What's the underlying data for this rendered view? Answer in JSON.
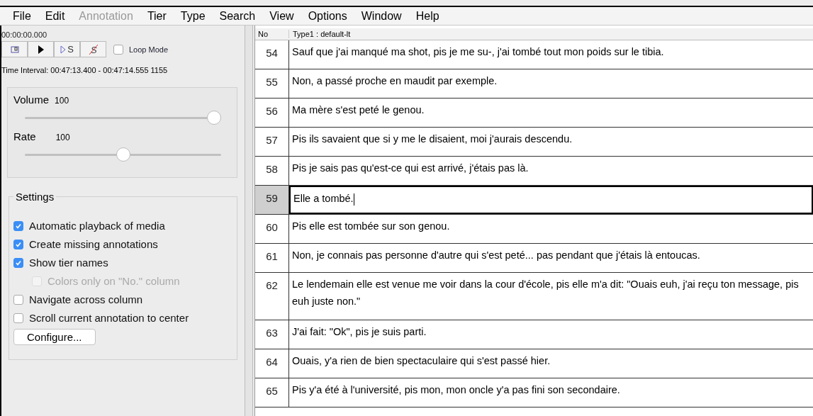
{
  "menu": [
    {
      "label": "File",
      "disabled": false
    },
    {
      "label": "Edit",
      "disabled": false
    },
    {
      "label": "Annotation",
      "disabled": true
    },
    {
      "label": "Tier",
      "disabled": false
    },
    {
      "label": "Type",
      "disabled": false
    },
    {
      "label": "Search",
      "disabled": false
    },
    {
      "label": "View",
      "disabled": false
    },
    {
      "label": "Options",
      "disabled": false
    },
    {
      "label": "Window",
      "disabled": false
    },
    {
      "label": "Help",
      "disabled": false
    }
  ],
  "player": {
    "time": "00:00:00.000",
    "buttons": [
      {
        "kind": "selection"
      },
      {
        "kind": "play"
      },
      {
        "kind": "play-s",
        "label": "S"
      },
      {
        "kind": "clear-s",
        "label": "S"
      }
    ],
    "loop_mode": {
      "label": "Loop Mode",
      "checked": false
    },
    "interval": "Time Interval: 00:47:13.400 - 00:47:14.555  1155"
  },
  "sliders": [
    {
      "label": "Volume",
      "reading": "100",
      "level": 1.0
    },
    {
      "label": "Rate",
      "reading": "100",
      "level": 0.5
    }
  ],
  "settings": {
    "title": "Settings",
    "options": [
      {
        "label": "Automatic playback of media",
        "checked": true,
        "disabled": false
      },
      {
        "label": "Create missing annotations",
        "checked": true,
        "disabled": false
      },
      {
        "label": "Show tier names",
        "checked": true,
        "disabled": false,
        "children": [
          {
            "label": "Colors only on \"No.\" column",
            "checked": false,
            "disabled": true
          }
        ]
      },
      {
        "label": "Navigate across column",
        "checked": false,
        "disabled": false
      },
      {
        "label": "Scroll current annotation to center",
        "checked": false,
        "disabled": false
      }
    ],
    "button": "Configure..."
  },
  "table": {
    "columns": [
      "No",
      "Type1 : default-lt"
    ],
    "rows": [
      {
        "no": "54",
        "text": "Sauf que j'ai manqué ma shot, pis je me su-, j'ai tombé tout mon poids sur le tibia.",
        "selected": false
      },
      {
        "no": "55",
        "text": "Non, a passé proche en maudit par exemple.",
        "selected": false
      },
      {
        "no": "56",
        "text": "Ma mère s'est peté le genou.",
        "selected": false
      },
      {
        "no": "57",
        "text": "Pis ils savaient que si y me le disaient, moi j'aurais descendu.",
        "selected": false
      },
      {
        "no": "58",
        "text": "Pis je sais pas qu'est-ce qui est arrivé, j'étais pas là.",
        "selected": false
      },
      {
        "no": "59",
        "text": "Elle a tombé.",
        "selected": true
      },
      {
        "no": "60",
        "text": "Pis elle est tombée sur son genou.",
        "selected": false
      },
      {
        "no": "61",
        "text": "Non, je connais pas personne d'autre qui s'est peté... pas pendant que j'étais là entoucas.",
        "selected": false
      },
      {
        "no": "62",
        "text": "Le lendemain elle est venue me voir dans la cour d'école, pis elle m'a dit: \"Ouais euh, j'ai reçu ton message, pis euh juste non.\"",
        "selected": false
      },
      {
        "no": "63",
        "text": "J'ai fait: \"Ok\", pis je suis parti.",
        "selected": false
      },
      {
        "no": "64",
        "text": "Ouais, y'a rien de bien spectaculaire qui s'est passé hier.",
        "selected": false
      },
      {
        "no": "65",
        "text": "Pis y'a été à l'université, pis mon, mon oncle y'a pas fini son secondaire.",
        "selected": false
      }
    ]
  }
}
